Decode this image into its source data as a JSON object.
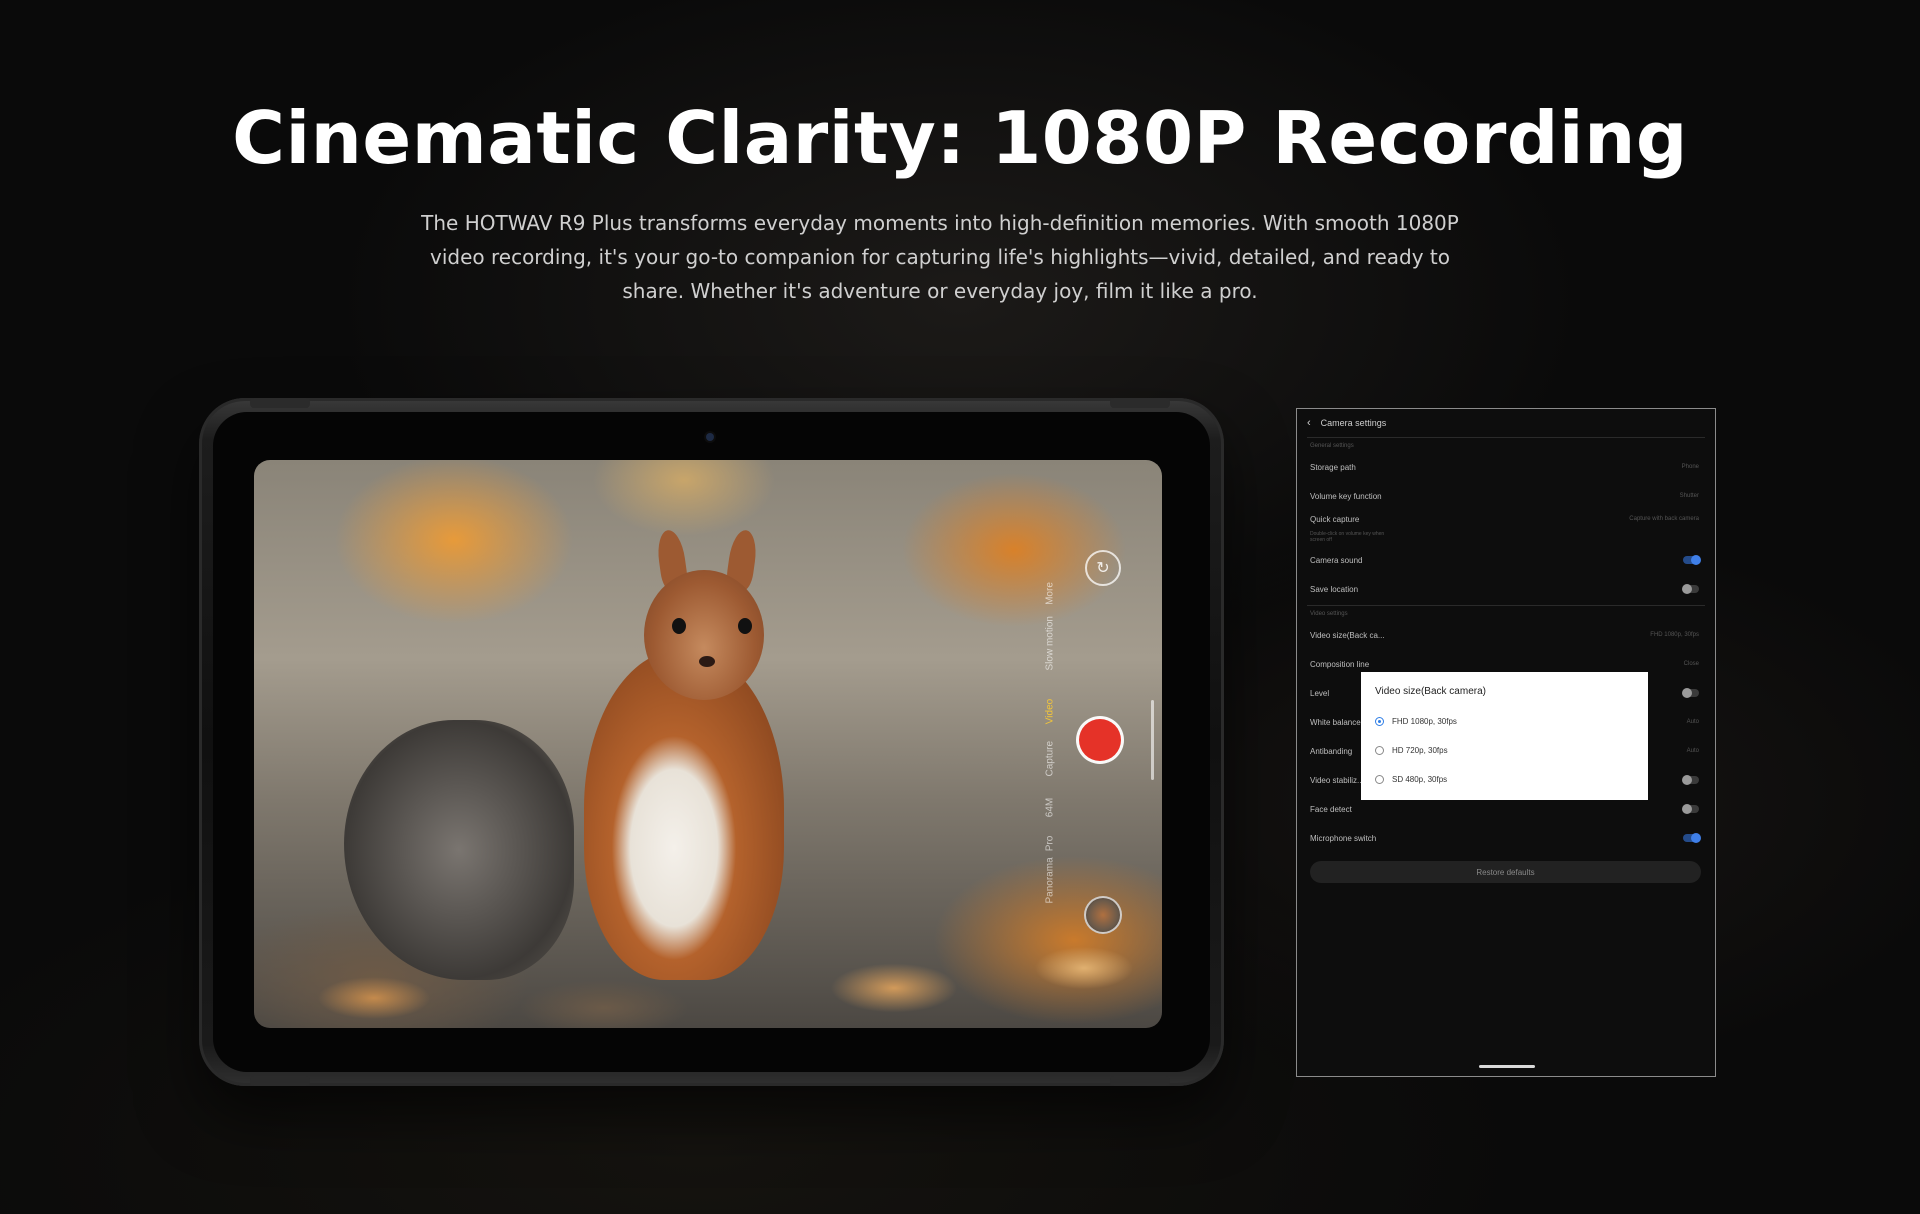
{
  "hero": {
    "title": "Cinematic Clarity: 1080P Recording",
    "description": "The HOTWAV R9 Plus transforms everyday moments into high-definition memories. With smooth 1080P video recording, it's your go-to companion for capturing life's highlights—vivid, detailed, and ready to share. Whether it's adventure or everyday joy, film it like a pro."
  },
  "camera_app": {
    "modes": [
      "More",
      "Slow motion",
      "Video",
      "Capture",
      "64M",
      "Pro",
      "Panorama"
    ],
    "active_mode": "Video",
    "icons": [
      "rotate-camera-icon",
      "record-button",
      "gallery-thumbnail"
    ]
  },
  "settings": {
    "header_title": "Camera settings",
    "section_general": "General settings",
    "section_video": "Video settings",
    "rows": {
      "storage_path": {
        "label": "Storage path",
        "value": "Phone"
      },
      "volume_key": {
        "label": "Volume key function",
        "value": "Shutter"
      },
      "quick_capture": {
        "label": "Quick capture",
        "sub": "Double-click on volume key when screen off",
        "value": "Capture with back camera"
      },
      "camera_sound": {
        "label": "Camera sound",
        "on": true
      },
      "save_location": {
        "label": "Save location",
        "on": false
      },
      "video_size": {
        "label": "Video size(Back ca...",
        "value": "FHD 1080p, 30fps"
      },
      "composition_line": {
        "label": "Composition line",
        "value": "Close"
      },
      "level": {
        "label": "Level",
        "on": false
      },
      "white_balance": {
        "label": "White balance",
        "value": "Auto"
      },
      "antibanding": {
        "label": "Antibanding",
        "value": "Auto"
      },
      "video_stabilization": {
        "label": "Video stabiliz...",
        "on": false
      },
      "face_detect": {
        "label": "Face detect",
        "on": false
      },
      "microphone_switch": {
        "label": "Microphone switch",
        "on": true
      }
    },
    "restore_label": "Restore defaults"
  },
  "dialog": {
    "title": "Video size(Back camera)",
    "options": [
      {
        "label": "FHD 1080p, 30fps",
        "checked": true
      },
      {
        "label": "HD 720p, 30fps",
        "checked": false
      },
      {
        "label": "SD 480p, 30fps",
        "checked": false
      }
    ]
  },
  "colors": {
    "record": "#e53228",
    "active_mode": "#f2c53a",
    "toggle_on": "#3f7fe8"
  }
}
